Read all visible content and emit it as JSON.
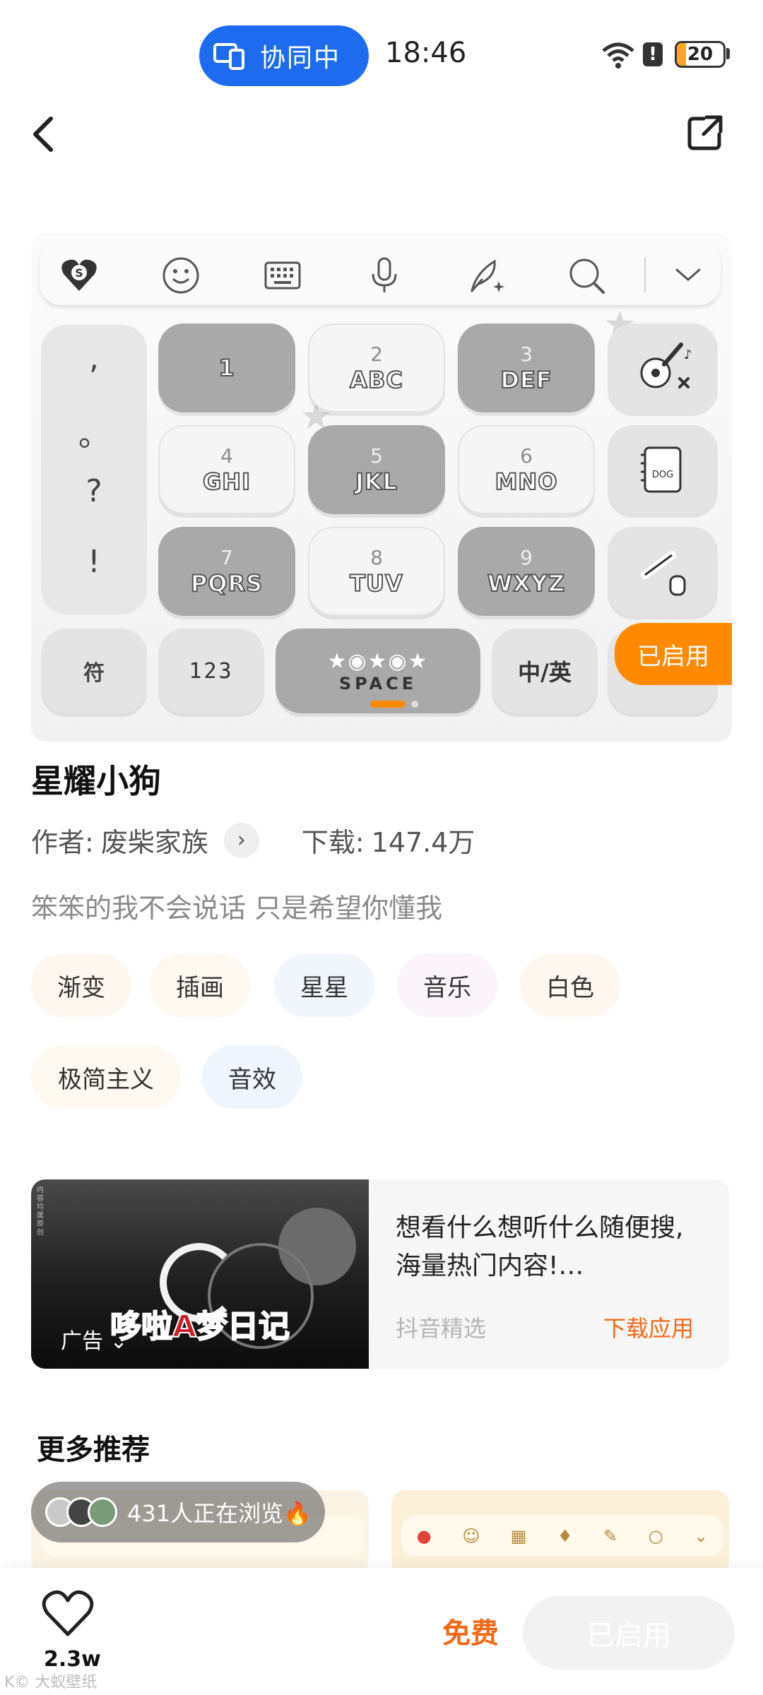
{
  "status_bar": {
    "cast_label": "协同中",
    "time": "18:46",
    "battery": "20",
    "battery_level": 0.2
  },
  "keyboard_preview": {
    "keys": {
      "k1": {
        "num": "",
        "letters": "1"
      },
      "k2": {
        "num": "2",
        "letters": "ABC"
      },
      "k3": {
        "num": "3",
        "letters": "DEF"
      },
      "k4": {
        "num": "4",
        "letters": "GHI"
      },
      "k5": {
        "num": "5",
        "letters": "JKL"
      },
      "k6": {
        "num": "6",
        "letters": "MNO"
      },
      "k7": {
        "num": "7",
        "letters": "PQRS"
      },
      "k8": {
        "num": "8",
        "letters": "TUV"
      },
      "k9": {
        "num": "9",
        "letters": "WXYZ"
      }
    },
    "punctuation": [
      ",",
      "。",
      "?",
      "!"
    ],
    "symbol_key": "符",
    "num_key": "123",
    "space_key": "SPACE",
    "lang_key": "中/英",
    "enabled_badge": "已启用",
    "page_index": 1,
    "page_count": 2
  },
  "theme": {
    "title": "星耀小狗",
    "author_label": "作者:",
    "author": "废柴家族",
    "downloads_label": "下载:",
    "downloads": "147.4万",
    "description": "笨笨的我不会说话 只是希望你懂我",
    "tags": [
      "渐变",
      "插画",
      "星星",
      "音乐",
      "白色",
      "极简主义",
      "音效"
    ]
  },
  "ad": {
    "image_title": "哆啦A梦日记",
    "ad_label": "广告",
    "text": "想看什么想听什么随便搜,海量热门内容!…",
    "source": "抖音精选",
    "cta": "下载应用"
  },
  "more": {
    "title": "更多推荐",
    "viewers": "431人正在浏览🔥"
  },
  "bottom_bar": {
    "like_count": "2.3w",
    "price": "免费",
    "action": "已启用",
    "watermark": "K© 大蚁壁纸"
  },
  "colors": {
    "accent": "#f06a1a",
    "badge": "#ff8a00",
    "cast_pill": "#1f6bf0"
  }
}
